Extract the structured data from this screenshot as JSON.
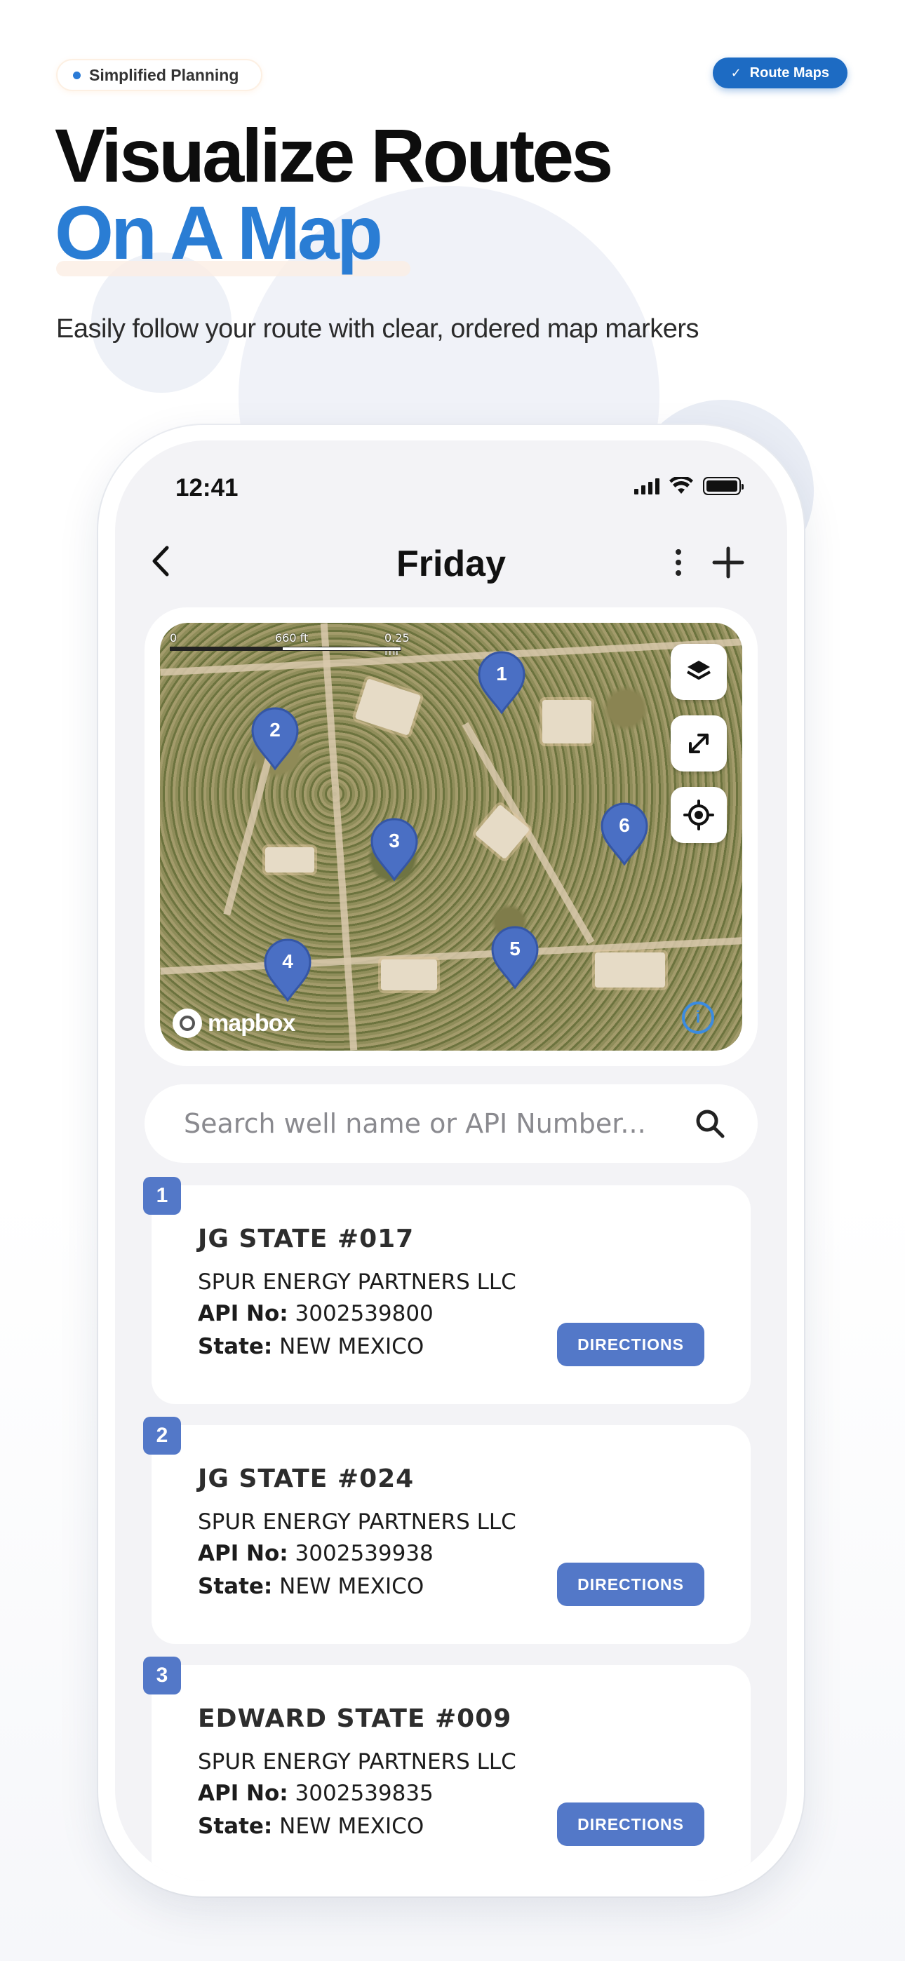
{
  "header": {
    "pill_left": "Simplified Planning",
    "pill_right": "Route Maps",
    "title_line1": "Visualize Routes",
    "title_line2": "On A Map",
    "subtitle": "Easily follow your route with clear, ordered map markers"
  },
  "status_bar": {
    "time": "12:41"
  },
  "nav": {
    "title": "Friday"
  },
  "map": {
    "scale_labels": [
      "0",
      "660 ft",
      "0.25 mi"
    ],
    "markers": [
      "1",
      "2",
      "3",
      "4",
      "5",
      "6"
    ],
    "attribution": "mapbox",
    "info_label": "i"
  },
  "search": {
    "placeholder": "Search well name or API Number..."
  },
  "wells": [
    {
      "number": "1",
      "name": "JG STATE #017",
      "company": "SPUR ENERGY PARTNERS LLC",
      "api_label": "API No:",
      "api": "3002539800",
      "state_label": "State:",
      "state": "NEW MEXICO",
      "button": "DIRECTIONS"
    },
    {
      "number": "2",
      "name": "JG STATE #024",
      "company": "SPUR ENERGY PARTNERS LLC",
      "api_label": "API No:",
      "api": "3002539938",
      "state_label": "State:",
      "state": "NEW MEXICO",
      "button": "DIRECTIONS"
    },
    {
      "number": "3",
      "name": "EDWARD STATE #009",
      "company": "SPUR ENERGY PARTNERS LLC",
      "api_label": "API No:",
      "api": "3002539835",
      "state_label": "State:",
      "state": "NEW MEXICO",
      "button": "DIRECTIONS"
    }
  ],
  "colors": {
    "accent": "#2a7dd4",
    "marker": "#4a6fc4",
    "button": "#5378c8"
  }
}
